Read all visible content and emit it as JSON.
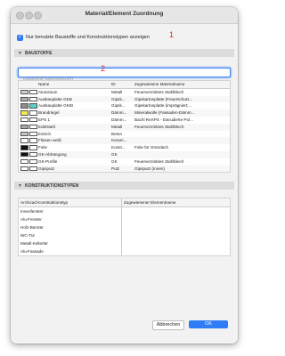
{
  "window": {
    "title": "Material/Element Zuordnung"
  },
  "filter": {
    "checkbox_label": "Nur benutzte Baustoffe und Konstruktionstypen anzeigen",
    "checked": true
  },
  "annotations": [
    "1",
    "2"
  ],
  "baustoffe": {
    "header": "BAUSTOFFE",
    "search_placeholder": "Baustoffe durchsuchen",
    "columns": {
      "name": "Name",
      "id": "ID",
      "assigned": "Zugewiesene Materialname"
    },
    "rows": [
      {
        "name": "Aluminium",
        "id": "Metall",
        "assigned": "Feuerverzinktes Stahlblech",
        "pattern_color": "#d0d0d0",
        "pattern_color2": "#ffffff"
      },
      {
        "name": "Ausbauplatte GKB",
        "id": "Gipsk...",
        "assigned": "Gipskartonplatte (Feuerschutz...",
        "pattern_color": "#b0b0b0",
        "pattern_color2": "#ffffff"
      },
      {
        "name": "Ausbauplatte GKBI",
        "id": "Gipsk...",
        "assigned": "Gipskartonplatte (imprägniert;...",
        "pattern_color": "#8e8e8e",
        "pattern_color2": "#59d0c5"
      },
      {
        "name": "Brandriegel",
        "id": "Dämm...",
        "assigned": "Mineralwolle (Fassaden-Dämm...",
        "pattern_color": "#f5ea4a",
        "pattern_color2": "#ffffff"
      },
      {
        "name": "EPS 1",
        "id": "Dämm...",
        "assigned": "Bachl ReXPS - Extrudierte Pol...",
        "pattern_color": "#ffffff",
        "pattern_color2": "#ffffff"
      },
      {
        "name": "Edelstahl",
        "id": "Metall",
        "assigned": "Feuerverzinktes Stahlblech",
        "pattern_color": "#a8a8a8",
        "pattern_color2": "#ffffff"
      },
      {
        "name": "Estrich",
        "id": "Beton",
        "assigned": "",
        "pattern_color": "#c8c8c8",
        "pattern_color2": "#ffffff"
      },
      {
        "name": "Fliesen weiß",
        "id": "Keram...",
        "assigned": "",
        "pattern_color": "#ffffff",
        "pattern_color2": "#ffffff"
      },
      {
        "name": "Folie",
        "id": "Kunst...",
        "assigned": "Folie für Gründach",
        "pattern_color": "#111111",
        "pattern_color2": "#ffffff"
      },
      {
        "name": "GK-Abhängung",
        "id": "GK",
        "assigned": "",
        "pattern_color": "#111111",
        "pattern_color2": "#ffffff"
      },
      {
        "name": "GK-Profile",
        "id": "GK",
        "assigned": "Feuerverzinktes Stahlblech",
        "pattern_color": "#ffffff",
        "pattern_color2": "#ffffff"
      },
      {
        "name": "Gipsputz",
        "id": "Putz",
        "assigned": "Gipsputz (Innen)",
        "pattern_color": "#ffffff",
        "pattern_color2": "#ffffff"
      }
    ]
  },
  "konstruktionstypen": {
    "header": "KONSTRUKTIONSTYPEN",
    "columns": {
      "type": "Archicad Konstruktionstyp",
      "assigned": "Zugewiesener Elementname"
    },
    "rows": [
      "Innenfenster",
      "Alu-Fenster",
      "Holz-Bürotür",
      "WC-Tür",
      "Metall-Kellertür",
      "Alu-Fassade"
    ]
  },
  "buttons": {
    "cancel": "Abbrechen",
    "ok": "OK"
  },
  "colors": {
    "accent": "#2f7cf6",
    "annotation": "#e0262f"
  }
}
